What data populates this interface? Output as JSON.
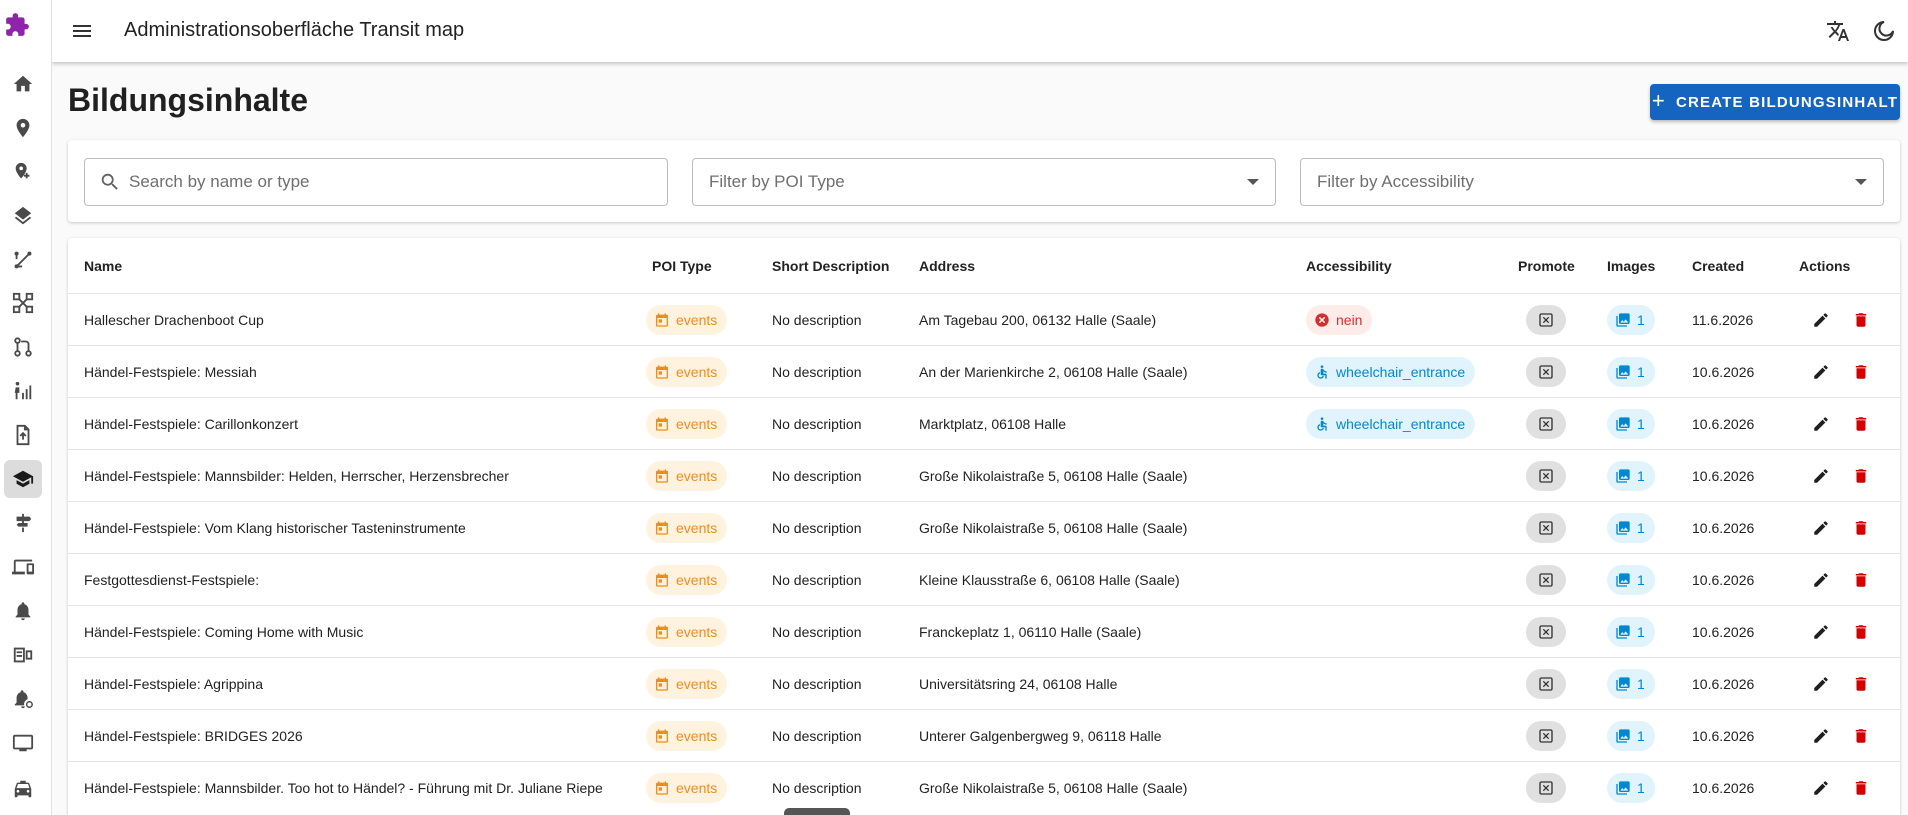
{
  "app": {
    "title": "Administrationsoberfläche Transit map",
    "accent": "#1565c0"
  },
  "sidebar": {
    "items": [
      {
        "icon": "home-icon",
        "active": false
      },
      {
        "icon": "location-pin-icon",
        "active": false
      },
      {
        "icon": "add-location-icon",
        "active": false
      },
      {
        "icon": "layers-icon",
        "active": false
      },
      {
        "icon": "route-icon",
        "active": false
      },
      {
        "icon": "network-icon",
        "active": false
      },
      {
        "icon": "transit-lines-icon",
        "active": false
      },
      {
        "icon": "accessibility-stats-icon",
        "active": false
      },
      {
        "icon": "file-upload-icon",
        "active": false
      },
      {
        "icon": "school-icon",
        "active": true
      },
      {
        "icon": "signpost-icon",
        "active": false
      },
      {
        "icon": "devices-icon",
        "active": false
      },
      {
        "icon": "alarm-bell-icon",
        "active": false
      },
      {
        "icon": "display-device-icon",
        "active": false
      },
      {
        "icon": "notification-settings-icon",
        "active": false
      },
      {
        "icon": "monitor-icon",
        "active": false
      },
      {
        "icon": "taxi-icon",
        "active": false
      }
    ]
  },
  "header": {
    "translate_icon": "translate-icon",
    "theme_icon": "dark-mode-icon"
  },
  "page": {
    "title": "Bildungsinhalte",
    "create_label": "CREATE BILDUNGSINHALT"
  },
  "filters": {
    "search_placeholder": "Search by name or type",
    "poi_type_placeholder": "Filter by POI Type",
    "accessibility_placeholder": "Filter by Accessibility"
  },
  "table": {
    "columns": [
      "Name",
      "POI Type",
      "Short Description",
      "Address",
      "Accessibility",
      "Promote",
      "Images",
      "Created",
      "Actions"
    ],
    "rows": [
      {
        "name": "Hallescher Drachenboot Cup",
        "poi_type": "events",
        "description": "No description",
        "address": "Am Tagebau 200, 06132 Halle (Saale)",
        "accessibility": "nein",
        "images": "1",
        "created": "11.6.2026"
      },
      {
        "name": "Händel-Festspiele: Messiah",
        "poi_type": "events",
        "description": "No description",
        "address": "An der Marienkirche 2, 06108 Halle (Saale)",
        "accessibility": "wheelchair_entrance",
        "images": "1",
        "created": "10.6.2026"
      },
      {
        "name": "Händel-Festspiele: Carillonkonzert",
        "poi_type": "events",
        "description": "No description",
        "address": "Marktplatz, 06108 Halle",
        "accessibility": "wheelchair_entrance",
        "images": "1",
        "created": "10.6.2026"
      },
      {
        "name": "Händel-Festspiele: Mannsbilder: Helden, Herrscher, Herzensbrecher",
        "poi_type": "events",
        "description": "No description",
        "address": "Große Nikolaistraße 5, 06108 Halle (Saale)",
        "accessibility": "",
        "images": "1",
        "created": "10.6.2026"
      },
      {
        "name": "Händel-Festspiele: Vom Klang historischer Tasteninstrumente",
        "poi_type": "events",
        "description": "No description",
        "address": "Große Nikolaistraße 5, 06108 Halle (Saale)",
        "accessibility": "",
        "images": "1",
        "created": "10.6.2026"
      },
      {
        "name": "Festgottesdienst-Festspiele:",
        "poi_type": "events",
        "description": "No description",
        "address": "Kleine Klausstraße 6, 06108 Halle (Saale)",
        "accessibility": "",
        "images": "1",
        "created": "10.6.2026"
      },
      {
        "name": "Händel-Festspiele: Coming Home with Music",
        "poi_type": "events",
        "description": "No description",
        "address": "Franckeplatz 1, 06110 Halle (Saale)",
        "accessibility": "",
        "images": "1",
        "created": "10.6.2026"
      },
      {
        "name": "Händel-Festspiele: Agrippina",
        "poi_type": "events",
        "description": "No description",
        "address": "Universitätsring 24, 06108 Halle",
        "accessibility": "",
        "images": "1",
        "created": "10.6.2026"
      },
      {
        "name": "Händel-Festspiele: BRIDGES 2026",
        "poi_type": "events",
        "description": "No description",
        "address": "Unterer Galgenbergweg 9, 06118 Halle",
        "accessibility": "",
        "images": "1",
        "created": "10.6.2026"
      },
      {
        "name": "Händel-Festspiele: Mannsbilder. Too hot to Händel? - Führung mit Dr. Juliane Riepe",
        "poi_type": "events",
        "description": "No description",
        "address": "Große Nikolaistraße 5, 06108 Halle (Saale)",
        "accessibility": "",
        "images": "1",
        "created": "10.6.2026"
      }
    ]
  },
  "colors": {
    "events": "#f08c1a",
    "access": "#0288d1",
    "nein": "#d32f2f",
    "delete": "#d50000"
  }
}
